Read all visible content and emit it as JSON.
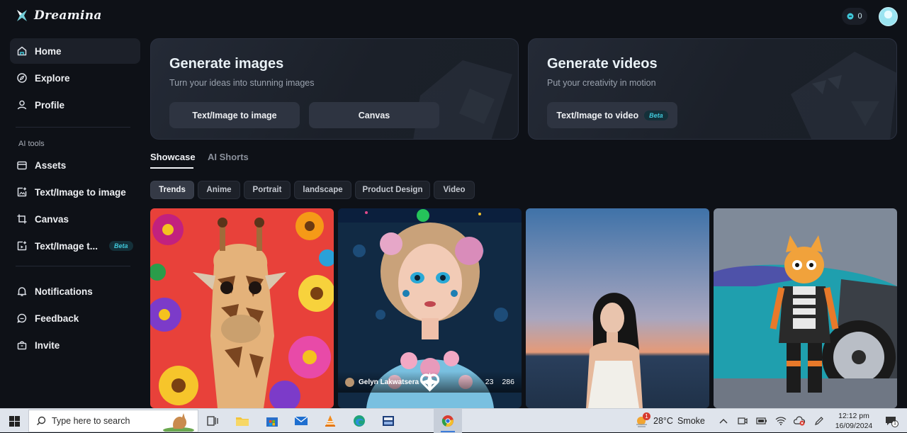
{
  "app": {
    "name": "Dreamina"
  },
  "sidebar": {
    "main_items": [
      {
        "label": "Home",
        "icon": "home-icon"
      },
      {
        "label": "Explore",
        "icon": "compass-icon"
      },
      {
        "label": "Profile",
        "icon": "user-icon"
      }
    ],
    "section_label": "AI tools",
    "tool_items": [
      {
        "label": "Assets",
        "icon": "folder-icon"
      },
      {
        "label": "Text/Image to image",
        "icon": "image-plus-icon"
      },
      {
        "label": "Canvas",
        "icon": "crop-icon"
      },
      {
        "label": "Text/Image t...",
        "icon": "video-plus-icon",
        "badge": "Beta"
      }
    ],
    "bottom_items": [
      {
        "label": "Notifications",
        "icon": "bell-icon"
      },
      {
        "label": "Feedback",
        "icon": "chat-icon"
      },
      {
        "label": "Invite",
        "icon": "gift-icon"
      }
    ]
  },
  "header": {
    "credits": "0"
  },
  "cards": {
    "images": {
      "title": "Generate images",
      "subtitle": "Turn your ideas into stunning images",
      "btn1": "Text/Image to image",
      "btn2": "Canvas"
    },
    "videos": {
      "title": "Generate videos",
      "subtitle": "Put your creativity in motion",
      "btn1": "Text/Image to video",
      "badge": "Beta"
    }
  },
  "tabs": [
    {
      "label": "Showcase"
    },
    {
      "label": "AI Shorts"
    }
  ],
  "chips": [
    "Trends",
    "Anime",
    "Portrait",
    "landscape",
    "Product Design",
    "Video"
  ],
  "gallery": {
    "tile2": {
      "author": "Gelyn Lakwatsera",
      "likes": "23",
      "remixes": "286"
    }
  },
  "taskbar": {
    "search_placeholder": "Type here to search",
    "weather_temp": "28°C",
    "weather_text": "Smoke",
    "weather_badge": "1",
    "time": "12:12 pm",
    "date": "16/09/2024",
    "notif_count": "1"
  },
  "colors": {
    "accent": "#3fc7d9",
    "sidebar_active": "#1c2029",
    "background": "#0e1117"
  }
}
